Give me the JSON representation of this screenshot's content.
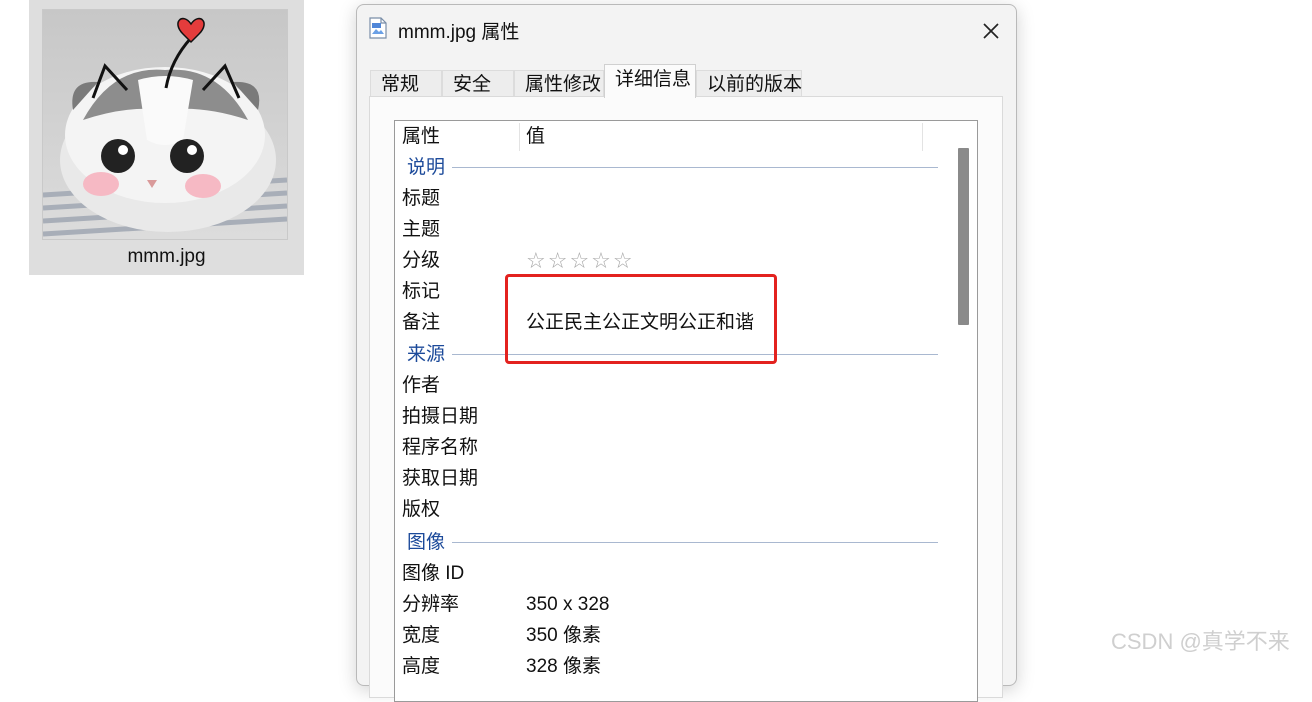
{
  "file": {
    "name": "mmm.jpg"
  },
  "dialog": {
    "title": "mmm.jpg 属性",
    "tabs": [
      {
        "label": "常规",
        "active": false
      },
      {
        "label": "安全",
        "active": false
      },
      {
        "label": "属性修改",
        "active": false
      },
      {
        "label": "详细信息",
        "active": true
      },
      {
        "label": "以前的版本",
        "active": false
      }
    ],
    "columns": {
      "property": "属性",
      "value": "值"
    },
    "groups": {
      "description": "说明",
      "origin": "来源",
      "image": "图像"
    },
    "rows": {
      "title": {
        "key": "标题",
        "value": ""
      },
      "subject": {
        "key": "主题",
        "value": ""
      },
      "rating": {
        "key": "分级",
        "stars": "☆☆☆☆☆",
        "value": 0
      },
      "tags": {
        "key": "标记",
        "value": ""
      },
      "comments": {
        "key": "备注",
        "value": "公正民主公正文明公正和谐"
      },
      "author": {
        "key": "作者",
        "value": ""
      },
      "date_taken": {
        "key": "拍摄日期",
        "value": ""
      },
      "program_name": {
        "key": "程序名称",
        "value": ""
      },
      "date_acquired": {
        "key": "获取日期",
        "value": ""
      },
      "copyright": {
        "key": "版权",
        "value": ""
      },
      "image_id": {
        "key": "图像 ID",
        "value": ""
      },
      "dimensions": {
        "key": "分辨率",
        "value": "350 x 328"
      },
      "width": {
        "key": "宽度",
        "value": "350 像素"
      },
      "height": {
        "key": "高度",
        "value": "328 像素"
      }
    },
    "scrollbar_position": 0.0
  },
  "watermark": "CSDN @真学不来",
  "colors": {
    "group_header": "#1c4a9a",
    "highlight": "#e3221f"
  }
}
